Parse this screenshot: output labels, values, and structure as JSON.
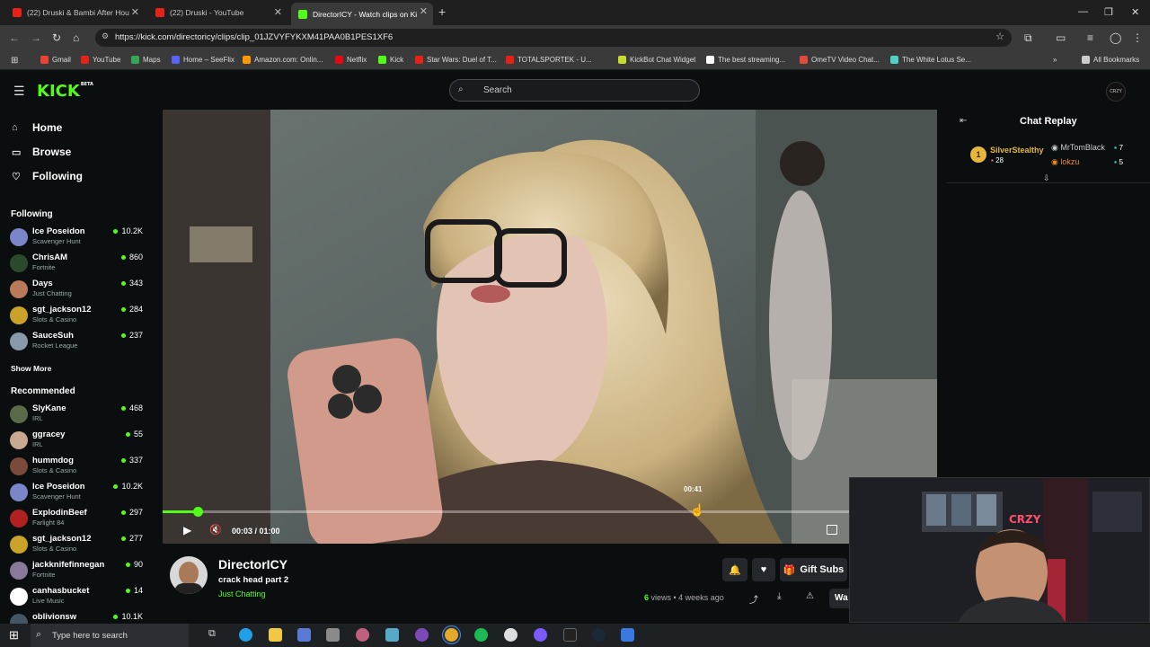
{
  "browser": {
    "tabs": [
      {
        "title": "(22) Druski & Bambi After Hou",
        "favicon_color": "#e62117"
      },
      {
        "title": "(22) Druski - YouTube",
        "favicon_color": "#e62117"
      },
      {
        "title": "DirectorICY - Watch clips on Ki",
        "favicon_color": "#53fc18",
        "active": true
      }
    ],
    "url": "https://kick.com/directoricy/clips/clip_01JZVYFYKXM41PAA0B1PES1XF6",
    "bookmarks": [
      {
        "label": "Gmail",
        "color": "#ea4335"
      },
      {
        "label": "YouTube",
        "color": "#e62117"
      },
      {
        "label": "Maps",
        "color": "#34a853"
      },
      {
        "label": "Home – SeeFlix",
        "color": "#5865f2"
      },
      {
        "label": "Amazon.com: Onlin...",
        "color": "#ff9900"
      },
      {
        "label": "Netflix",
        "color": "#e50914"
      },
      {
        "label": "Kick",
        "color": "#53fc18"
      },
      {
        "label": "Star Wars: Duel of T...",
        "color": "#e62117"
      },
      {
        "label": "TOTALSPORTEK - U...",
        "color": "#e62117"
      },
      {
        "label": "KickBot Chat Widget",
        "color": "#c8d930"
      },
      {
        "label": "The best streaming...",
        "color": "#ffffff"
      },
      {
        "label": "OmeTV Video Chat...",
        "color": "#e24a3b"
      },
      {
        "label": "The White Lotus Se...",
        "color": "#4fd1c5"
      }
    ],
    "all_bookmarks_label": "All Bookmarks"
  },
  "kick": {
    "logo": "KICK",
    "logo_badge": "BETA",
    "search_placeholder": "Search",
    "profile_badge": "CRZY"
  },
  "sidebar": {
    "nav": [
      {
        "label": "Home",
        "icon": "home-icon"
      },
      {
        "label": "Browse",
        "icon": "browse-icon"
      },
      {
        "label": "Following",
        "icon": "heart-icon"
      }
    ],
    "following_title": "Following",
    "following": [
      {
        "name": "Ice Poseidon",
        "category": "Scavenger Hunt",
        "viewers": "10.2K",
        "color": "#7a86c9"
      },
      {
        "name": "ChrisAM",
        "category": "Fortnite",
        "viewers": "860",
        "color": "#2b4a2b"
      },
      {
        "name": "Days",
        "category": "Just Chatting",
        "viewers": "343",
        "color": "#b87a5a"
      },
      {
        "name": "sgt_jackson12",
        "category": "Slots & Casino",
        "viewers": "284",
        "color": "#c9a227"
      },
      {
        "name": "SauceSuh",
        "category": "Rocket League",
        "viewers": "237",
        "color": "#8899aa"
      }
    ],
    "show_more": "Show More",
    "recommended_title": "Recommended",
    "recommended": [
      {
        "name": "SlyKane",
        "category": "IRL",
        "viewers": "468",
        "color": "#5a6a4a"
      },
      {
        "name": "ggracey",
        "category": "IRL",
        "viewers": "55",
        "color": "#c9a890"
      },
      {
        "name": "hummdog",
        "category": "Slots & Casino",
        "viewers": "337",
        "color": "#7a4a3a"
      },
      {
        "name": "Ice Poseidon",
        "category": "Scavenger Hunt",
        "viewers": "10.2K",
        "color": "#7a86c9"
      },
      {
        "name": "ExplodinBeef",
        "category": "Farlight 84",
        "viewers": "297",
        "color": "#b02020"
      },
      {
        "name": "sgt_jackson12",
        "category": "Slots & Casino",
        "viewers": "277",
        "color": "#c9a227"
      },
      {
        "name": "jackknifefinnegan",
        "category": "Fortnite",
        "viewers": "90",
        "color": "#8a7a9a"
      },
      {
        "name": "canhasbucket",
        "category": "Live Music",
        "viewers": "14",
        "color": "#ffffff"
      },
      {
        "name": "oblivionsw",
        "category": "",
        "viewers": "10.1K",
        "color": "#445566"
      }
    ]
  },
  "player": {
    "current_time": "00:03",
    "duration": "01:00",
    "time_display": "00:03 / 01:00",
    "hover_time": "00:41",
    "progress": 0.05,
    "hover_position": 0.68
  },
  "clip": {
    "channel": "DirectorICY",
    "title": "crack head part 2",
    "category": "Just Chatting",
    "views_count": "6",
    "views_suffix": " views • 4 weeks ago",
    "gift_subs_label": "Gift Subs",
    "watch_label": "Wa"
  },
  "chat": {
    "title": "Chat Replay",
    "leaderboard": [
      {
        "rank": "1",
        "name": "SilverStealthy",
        "count": "28",
        "color": "#e7b63d"
      },
      {
        "name": "MrTomBlack",
        "count": "7",
        "color": "#cccccc"
      },
      {
        "name": "lokzu",
        "count": "5",
        "color": "#e88a2a"
      }
    ]
  },
  "taskbar": {
    "search_placeholder": "Type here to search"
  },
  "webcam": {
    "sign_text": "CRZY"
  }
}
